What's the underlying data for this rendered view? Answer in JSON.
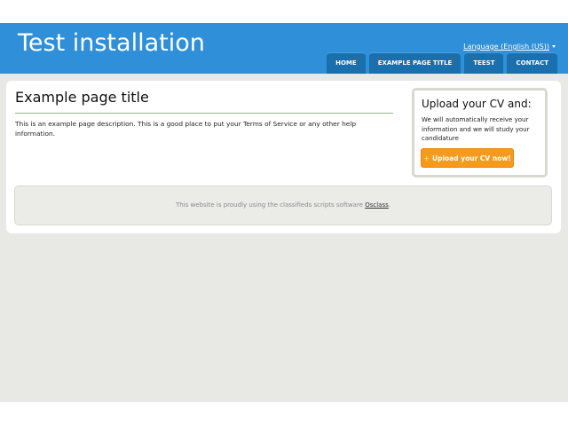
{
  "header": {
    "site_title": "Test installation",
    "language_label": "Language (English (US))"
  },
  "nav": {
    "items": [
      {
        "label": "HOME"
      },
      {
        "label": "EXAMPLE PAGE TITLE"
      },
      {
        "label": "TEEST"
      },
      {
        "label": "CONTACT"
      }
    ]
  },
  "main": {
    "page_title": "Example page title",
    "page_description": "This is an example page description. This is a good place to put your Terms of Service or any other help information."
  },
  "cv_widget": {
    "title": "Upload your CV and:",
    "text": "We will automatically receive your information and we will study your candidature",
    "button_icon": "plus-icon",
    "button_label": "Upload your CV now!"
  },
  "footer": {
    "text": "This website is proudly using the classifieds scripts software ",
    "link_label": "Osclass",
    "suffix": "."
  },
  "colors": {
    "header_blue": "#2f8fd8",
    "nav_tab": "#1a6fad",
    "button_orange": "#f59a1a",
    "title_rule_green": "#8fbf6a",
    "page_background": "#e8e8e4"
  }
}
